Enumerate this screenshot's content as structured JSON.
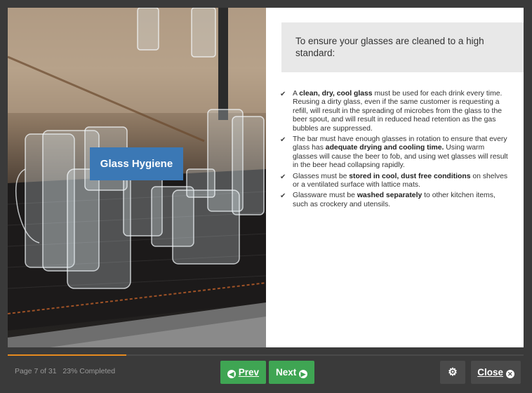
{
  "slide": {
    "image_badge": "Glass Hygiene",
    "callout": "To ensure your glasses are cleaned to a high standard:",
    "bullets": [
      {
        "pre": "A ",
        "bold": "clean, dry, cool glass",
        "post": " must be used for each drink every time. Reusing a dirty glass, even if the same customer is requesting a refill, will result in the spreading of microbes from the glass to the beer spout, and will result in reduced head retention as the gas bubbles are suppressed."
      },
      {
        "pre": "The bar must have enough glasses in rotation to ensure that every glass has ",
        "bold": "adequate drying and cooling time.",
        "post": " Using warm glasses will cause the beer to fob, and using wet glasses will result in the beer head collapsing rapidly."
      },
      {
        "pre": "Glasses must be ",
        "bold": "stored in cool, dust free conditions",
        "post": " on shelves or a ventilated surface with lattice mats."
      },
      {
        "pre": "Glassware must be ",
        "bold": "washed separately",
        "post": " to other kitchen items, such as crockery and utensils."
      }
    ]
  },
  "footer": {
    "page_status": "Page 7 of 31",
    "completed": "23% Completed",
    "progress_fraction": 0.23,
    "prev_label": "Prev",
    "next_label": "Next",
    "close_label": "Close"
  },
  "icons": {
    "check": "check-icon",
    "settings": "gears-icon",
    "prev": "chevron-left-circle-icon",
    "next": "chevron-right-circle-icon",
    "close": "x-circle-icon"
  },
  "colors": {
    "accent_green": "#3fa553",
    "badge_blue": "#3b78b5",
    "progress_orange": "#e58a1f"
  }
}
